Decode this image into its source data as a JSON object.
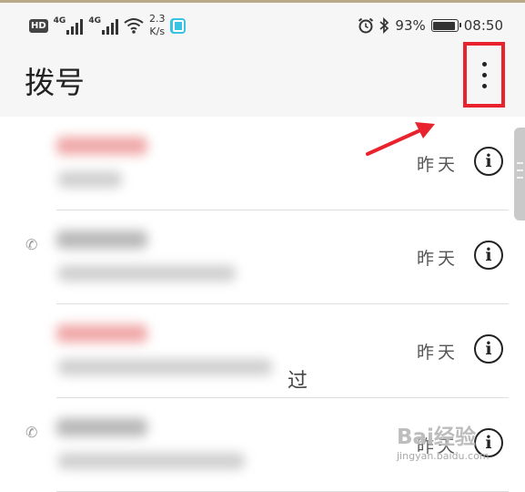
{
  "status_bar": {
    "hd_label": "HD",
    "sim1_label": "4G",
    "sim2_label": "4G",
    "speed_value": "2.3",
    "speed_unit": "K/s",
    "battery": "93%",
    "battery_level": 0.93,
    "time": "08:50",
    "icons": [
      "signal-icon",
      "wifi-icon",
      "alarm-icon",
      "bluetooth-icon",
      "battery-icon"
    ]
  },
  "app_bar": {
    "title": "拨号",
    "more_icon": "more-vertical-icon"
  },
  "calls": [
    {
      "date": "昨天",
      "name_color": "#f0a8a8",
      "has_call_icon": false,
      "suffix": ""
    },
    {
      "date": "昨天",
      "name_color": "#b8b8b8",
      "has_call_icon": true,
      "suffix": ""
    },
    {
      "date": "昨天",
      "name_color": "#f0a8a8",
      "has_call_icon": false,
      "suffix": "过"
    },
    {
      "date": "昨天",
      "name_color": "#b8b8b8",
      "has_call_icon": true,
      "suffix": ""
    }
  ],
  "watermark": {
    "main": "Bai经验",
    "sub": "jingyan.baidu.com"
  },
  "colors": {
    "highlight_red": "#e8232d",
    "bar_background": "#f6f6f6"
  }
}
